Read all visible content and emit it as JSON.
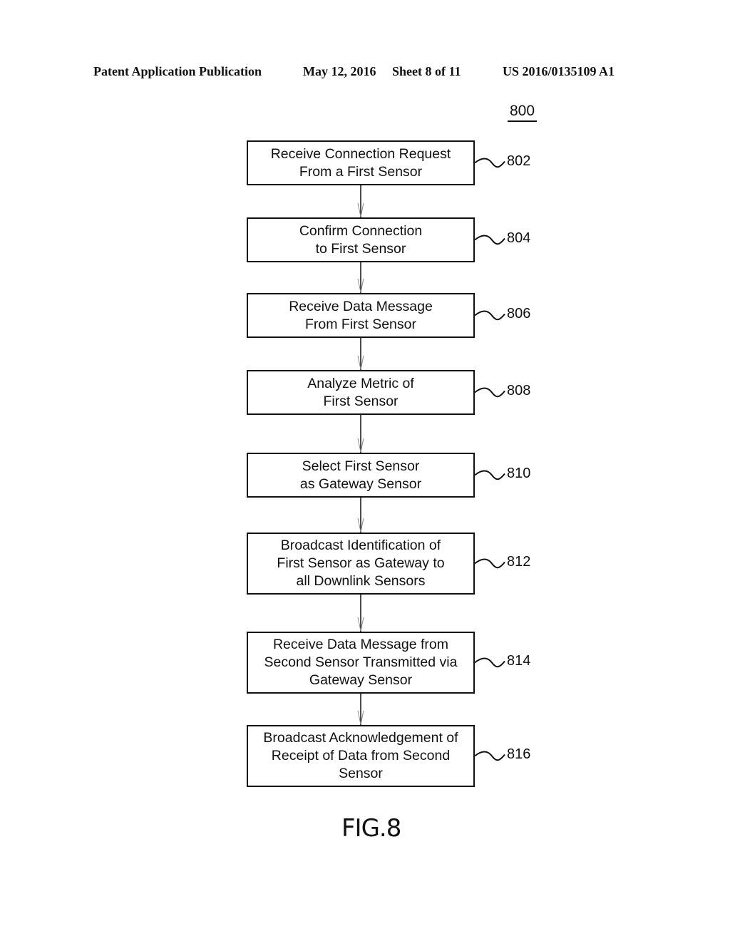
{
  "header": {
    "publication": "Patent Application Publication",
    "date": "May 12, 2016",
    "sheet": "Sheet 8 of 11",
    "number": "US 2016/0135109 A1"
  },
  "figure": {
    "ref_number": "800",
    "label": "FIG.8"
  },
  "steps": [
    {
      "ref": "802",
      "text": "Receive Connection Request\nFrom a First Sensor"
    },
    {
      "ref": "804",
      "text": "Confirm Connection\nto First Sensor"
    },
    {
      "ref": "806",
      "text": "Receive Data Message\nFrom First Sensor"
    },
    {
      "ref": "808",
      "text": "Analyze Metric of\nFirst Sensor"
    },
    {
      "ref": "810",
      "text": "Select First Sensor\nas Gateway Sensor"
    },
    {
      "ref": "812",
      "text": "Broadcast Identification of\nFirst Sensor as Gateway to\nall Downlink Sensors"
    },
    {
      "ref": "814",
      "text": "Receive Data Message from\nSecond Sensor Transmitted via\nGateway Sensor"
    },
    {
      "ref": "816",
      "text": "Broadcast Acknowledgement of\nReceipt of Data from Second\nSensor"
    }
  ]
}
